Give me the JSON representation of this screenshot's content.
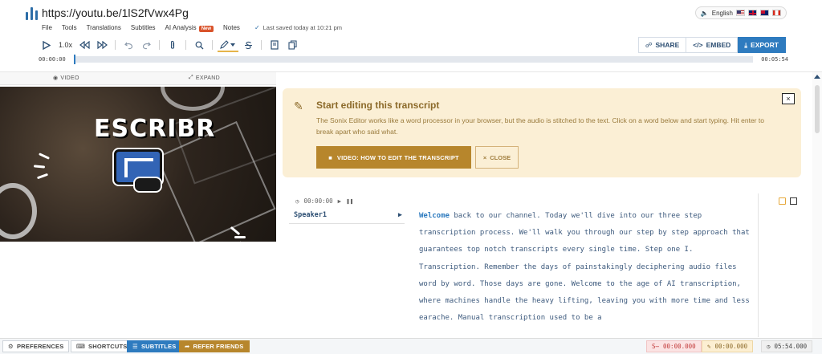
{
  "header": {
    "url": "https://youtu.be/1lS2fVwx4Pg",
    "language": "English",
    "menu": [
      {
        "label": "File"
      },
      {
        "label": "Tools"
      },
      {
        "label": "Translations"
      },
      {
        "label": "Subtitles"
      },
      {
        "label": "AI Analysis",
        "badge": "New"
      },
      {
        "label": "Notes"
      }
    ],
    "saved_status": "Last saved today at 10:21 pm",
    "playback_speed": "1.0x",
    "actions": {
      "share": "SHARE",
      "embed": "EMBED",
      "export": "EXPORT"
    },
    "timeline": {
      "current": "00:00:00",
      "total": "00:05:54",
      "progress": 0
    }
  },
  "video_pane": {
    "tab_video": "VIDEO",
    "tab_expand": "EXPAND",
    "brand_text": "ESCRIBR"
  },
  "tip": {
    "title": "Start editing this transcript",
    "body": "The Sonix Editor works like a word processor in your browser, but the audio is stitched to the text. Click on a word below and start typing. Hit enter to break apart who said what.",
    "video_button": "VIDEO: HOW TO EDIT THE TRANSCRIPT",
    "close_button": "CLOSE",
    "dismiss": "×"
  },
  "segment": {
    "time": "00:00:00",
    "speaker": "Speaker1",
    "first_word": "Welcome",
    "text": " back to our channel. Today we'll dive into our three step transcription process. We'll walk you through our step by step approach that guarantees top notch transcripts every single time. Step one I. Transcription. Remember the days of painstakingly deciphering audio files word by word. Those days are gone. Welcome to the age of AI transcription, where machines handle the heavy lifting, leaving you with more time and less earache. Manual transcription used to be a"
  },
  "bottom": {
    "preferences": "PREFERENCES",
    "shortcuts": "SHORTCUTS",
    "subtitles": "SUBTITLES",
    "refer": "REFER FRIENDS",
    "time_strike": "00:00.000",
    "time_edit": "00:00.000",
    "time_total": "05:54.000"
  },
  "colors": {
    "accent": "#2e7bbf",
    "navy": "#2d4f73",
    "gold": "#b7862c",
    "tip_bg": "#fbefd5",
    "badge": "#d9532b"
  },
  "icons": {
    "logo": "waveform-logo-icon",
    "play": "play-icon",
    "rewind": "rewind-icon",
    "forward": "fast-forward-icon",
    "undo": "undo-icon",
    "redo": "redo-icon",
    "attach": "paperclip-icon",
    "search": "search-icon",
    "highlight": "highlighter-icon",
    "strike": "strikethrough-icon",
    "book": "book-icon",
    "copy": "copy-icon"
  }
}
